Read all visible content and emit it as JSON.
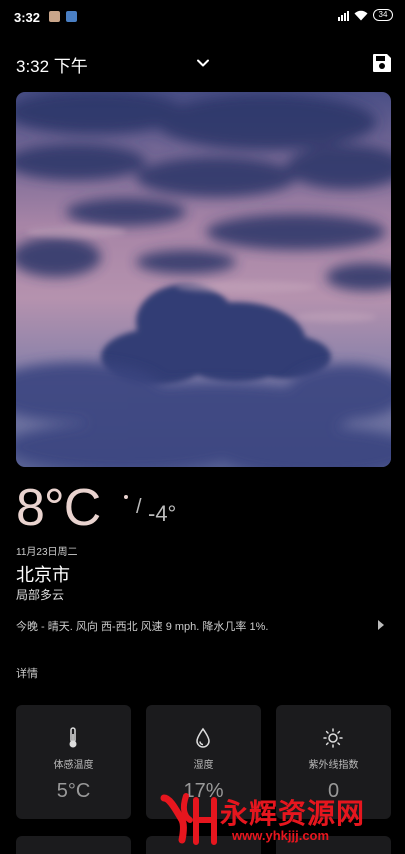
{
  "status_bar": {
    "time": "3:32",
    "battery": "34"
  },
  "header": {
    "time_label": "3:32 下午"
  },
  "weather": {
    "temperature": "8°C",
    "low_temp": "-4°",
    "date": "11月23日周二",
    "city": "北京市",
    "condition": "局部多云",
    "forecast": "今晚 - 晴天. 风向 西-西北 风速 9 mph. 降水几率 1%."
  },
  "details": {
    "title": "详情",
    "cards": [
      {
        "label": "体感温度",
        "value": "5°C",
        "icon": "thermometer-icon"
      },
      {
        "label": "湿度",
        "value": "17%",
        "icon": "droplet-icon"
      },
      {
        "label": "紫外线指数",
        "value": "0",
        "icon": "sun-icon"
      }
    ]
  },
  "watermark": {
    "title": "永辉资源网",
    "url": "www.yhkjjj.com"
  },
  "colors": {
    "background": "#000000",
    "card": "#1b1b1d",
    "temperature": "#e9d3cf",
    "watermark": "#e6161e"
  }
}
